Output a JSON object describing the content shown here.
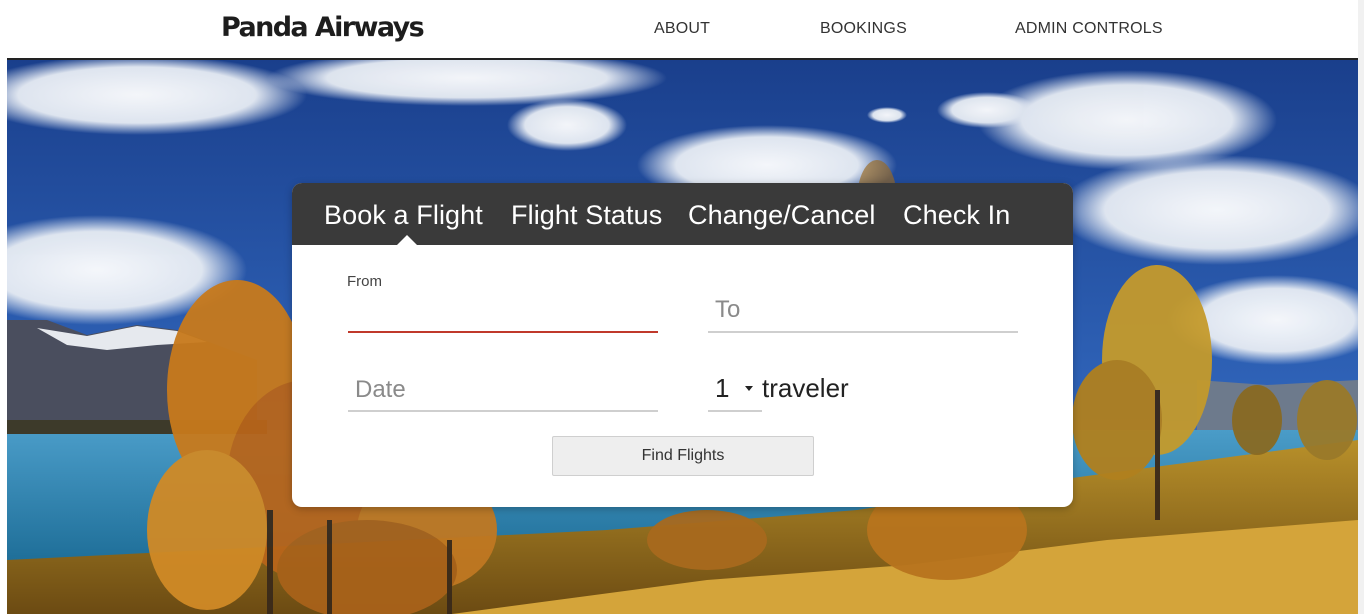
{
  "header": {
    "logo": "Panda Airways",
    "nav": {
      "about": "ABOUT",
      "bookings": "BOOKINGS",
      "admin": "ADMIN CONTROLS"
    }
  },
  "booking": {
    "tabs": {
      "book": "Book a Flight",
      "status": "Flight Status",
      "change": "Change/Cancel",
      "checkin": "Check In"
    },
    "active_tab": "Book a Flight",
    "from": {
      "label": "From",
      "value": ""
    },
    "to": {
      "placeholder": "To",
      "value": ""
    },
    "date": {
      "placeholder": "Date",
      "value": ""
    },
    "travelers": {
      "count": "1",
      "label": "traveler"
    },
    "find_button": "Find Flights"
  },
  "colors": {
    "tab_bar": "#3a3a3a",
    "active_field_underline": "#c0392b",
    "field_underline": "#cfcfcf",
    "button_bg": "#eeeeee"
  }
}
